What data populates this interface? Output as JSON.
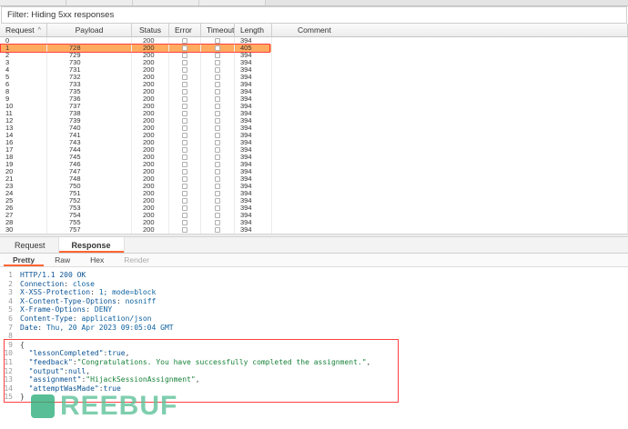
{
  "filter_bar": {
    "label": "Filter: Hiding 5xx responses"
  },
  "results_table": {
    "columns": {
      "request": "Request",
      "payload": "Payload",
      "status": "Status",
      "error": "Error",
      "timeout": "Timeout",
      "length": "Length",
      "comment": "Comment"
    },
    "sort_indicator": "^",
    "rows": [
      {
        "request": "0",
        "payload": "",
        "status": "200",
        "length": "394",
        "comment": "",
        "selected": false
      },
      {
        "request": "1",
        "payload": "728",
        "status": "200",
        "length": "405",
        "comment": "",
        "selected": true
      },
      {
        "request": "2",
        "payload": "729",
        "status": "200",
        "length": "394",
        "comment": "",
        "selected": false
      },
      {
        "request": "3",
        "payload": "730",
        "status": "200",
        "length": "394",
        "comment": "",
        "selected": false
      },
      {
        "request": "4",
        "payload": "731",
        "status": "200",
        "length": "394",
        "comment": "",
        "selected": false
      },
      {
        "request": "5",
        "payload": "732",
        "status": "200",
        "length": "394",
        "comment": "",
        "selected": false
      },
      {
        "request": "6",
        "payload": "733",
        "status": "200",
        "length": "394",
        "comment": "",
        "selected": false
      },
      {
        "request": "8",
        "payload": "735",
        "status": "200",
        "length": "394",
        "comment": "",
        "selected": false
      },
      {
        "request": "9",
        "payload": "736",
        "status": "200",
        "length": "394",
        "comment": "",
        "selected": false
      },
      {
        "request": "10",
        "payload": "737",
        "status": "200",
        "length": "394",
        "comment": "",
        "selected": false
      },
      {
        "request": "11",
        "payload": "738",
        "status": "200",
        "length": "394",
        "comment": "",
        "selected": false
      },
      {
        "request": "12",
        "payload": "739",
        "status": "200",
        "length": "394",
        "comment": "",
        "selected": false
      },
      {
        "request": "13",
        "payload": "740",
        "status": "200",
        "length": "394",
        "comment": "",
        "selected": false
      },
      {
        "request": "14",
        "payload": "741",
        "status": "200",
        "length": "394",
        "comment": "",
        "selected": false
      },
      {
        "request": "16",
        "payload": "743",
        "status": "200",
        "length": "394",
        "comment": "",
        "selected": false
      },
      {
        "request": "17",
        "payload": "744",
        "status": "200",
        "length": "394",
        "comment": "",
        "selected": false
      },
      {
        "request": "18",
        "payload": "745",
        "status": "200",
        "length": "394",
        "comment": "",
        "selected": false
      },
      {
        "request": "19",
        "payload": "746",
        "status": "200",
        "length": "394",
        "comment": "",
        "selected": false
      },
      {
        "request": "20",
        "payload": "747",
        "status": "200",
        "length": "394",
        "comment": "",
        "selected": false
      },
      {
        "request": "21",
        "payload": "748",
        "status": "200",
        "length": "394",
        "comment": "",
        "selected": false
      },
      {
        "request": "23",
        "payload": "750",
        "status": "200",
        "length": "394",
        "comment": "",
        "selected": false
      },
      {
        "request": "24",
        "payload": "751",
        "status": "200",
        "length": "394",
        "comment": "",
        "selected": false
      },
      {
        "request": "25",
        "payload": "752",
        "status": "200",
        "length": "394",
        "comment": "",
        "selected": false
      },
      {
        "request": "26",
        "payload": "753",
        "status": "200",
        "length": "394",
        "comment": "",
        "selected": false
      },
      {
        "request": "27",
        "payload": "754",
        "status": "200",
        "length": "394",
        "comment": "",
        "selected": false
      },
      {
        "request": "28",
        "payload": "755",
        "status": "200",
        "length": "394",
        "comment": "",
        "selected": false
      },
      {
        "request": "30",
        "payload": "757",
        "status": "200",
        "length": "394",
        "comment": "",
        "selected": false
      }
    ]
  },
  "editor": {
    "tabs": [
      {
        "label": "Request",
        "selected": false
      },
      {
        "label": "Response",
        "selected": true
      }
    ],
    "view_tabs": [
      {
        "label": "Pretty",
        "selected": true,
        "enabled": true
      },
      {
        "label": "Raw",
        "selected": false,
        "enabled": true
      },
      {
        "label": "Hex",
        "selected": false,
        "enabled": true
      },
      {
        "label": "Render",
        "selected": false,
        "enabled": false
      }
    ],
    "response_lines": [
      {
        "num": "1",
        "segments": [
          {
            "text": "HTTP/1.1 200 OK",
            "style": "status-line"
          }
        ]
      },
      {
        "num": "2",
        "segments": [
          {
            "text": "Connection",
            "style": "header-name"
          },
          {
            "text": ": ",
            "style": "punct"
          },
          {
            "text": "close",
            "style": "header-value"
          }
        ]
      },
      {
        "num": "3",
        "segments": [
          {
            "text": "X-XSS-Protection",
            "style": "header-name"
          },
          {
            "text": ": ",
            "style": "punct"
          },
          {
            "text": "1; mode=block",
            "style": "header-value"
          }
        ]
      },
      {
        "num": "4",
        "segments": [
          {
            "text": "X-Content-Type-Options",
            "style": "header-name"
          },
          {
            "text": ": ",
            "style": "punct"
          },
          {
            "text": "nosniff",
            "style": "header-value"
          }
        ]
      },
      {
        "num": "5",
        "segments": [
          {
            "text": "X-Frame-Options",
            "style": "header-name"
          },
          {
            "text": ": ",
            "style": "punct"
          },
          {
            "text": "DENY",
            "style": "header-value"
          }
        ]
      },
      {
        "num": "6",
        "segments": [
          {
            "text": "Content-Type",
            "style": "header-name"
          },
          {
            "text": ": ",
            "style": "punct"
          },
          {
            "text": "application/json",
            "style": "header-value"
          }
        ]
      },
      {
        "num": "7",
        "segments": [
          {
            "text": "Date",
            "style": "header-name"
          },
          {
            "text": ": ",
            "style": "punct"
          },
          {
            "text": "Thu, 20 Apr 2023 09:05:04 GMT",
            "style": "header-value"
          }
        ]
      },
      {
        "num": "8",
        "segments": []
      },
      {
        "num": "9",
        "segments": [
          {
            "text": "{",
            "style": "punct"
          }
        ]
      },
      {
        "num": "10",
        "segments": [
          {
            "text": "  ",
            "style": "punct"
          },
          {
            "text": "\"lessonCompleted\"",
            "style": "key"
          },
          {
            "text": ":",
            "style": "punct"
          },
          {
            "text": "true",
            "style": "bool"
          },
          {
            "text": ",",
            "style": "punct"
          }
        ]
      },
      {
        "num": "11",
        "segments": [
          {
            "text": "  ",
            "style": "punct"
          },
          {
            "text": "\"feedback\"",
            "style": "key"
          },
          {
            "text": ":",
            "style": "punct"
          },
          {
            "text": "\"Congratulations. You have successfully completed the assignment.\"",
            "style": "string"
          },
          {
            "text": ",",
            "style": "punct"
          }
        ]
      },
      {
        "num": "12",
        "segments": [
          {
            "text": "  ",
            "style": "punct"
          },
          {
            "text": "\"output\"",
            "style": "key"
          },
          {
            "text": ":",
            "style": "punct"
          },
          {
            "text": "null",
            "style": "bool"
          },
          {
            "text": ",",
            "style": "punct"
          }
        ]
      },
      {
        "num": "13",
        "segments": [
          {
            "text": "  ",
            "style": "punct"
          },
          {
            "text": "\"assignment\"",
            "style": "key"
          },
          {
            "text": ":",
            "style": "punct"
          },
          {
            "text": "\"HijackSessionAssignment\"",
            "style": "string"
          },
          {
            "text": ",",
            "style": "punct"
          }
        ]
      },
      {
        "num": "14",
        "segments": [
          {
            "text": "  ",
            "style": "punct"
          },
          {
            "text": "\"attemptWasMade\"",
            "style": "key"
          },
          {
            "text": ":",
            "style": "punct"
          },
          {
            "text": "true",
            "style": "bool"
          }
        ]
      },
      {
        "num": "15",
        "segments": [
          {
            "text": "}",
            "style": "punct"
          }
        ]
      }
    ]
  },
  "watermark": {
    "text": "REEBUF"
  },
  "colors": {
    "selection_orange": "#ffab60",
    "annotation_red": "#ff4040",
    "accent_orange": "#ff6633"
  }
}
